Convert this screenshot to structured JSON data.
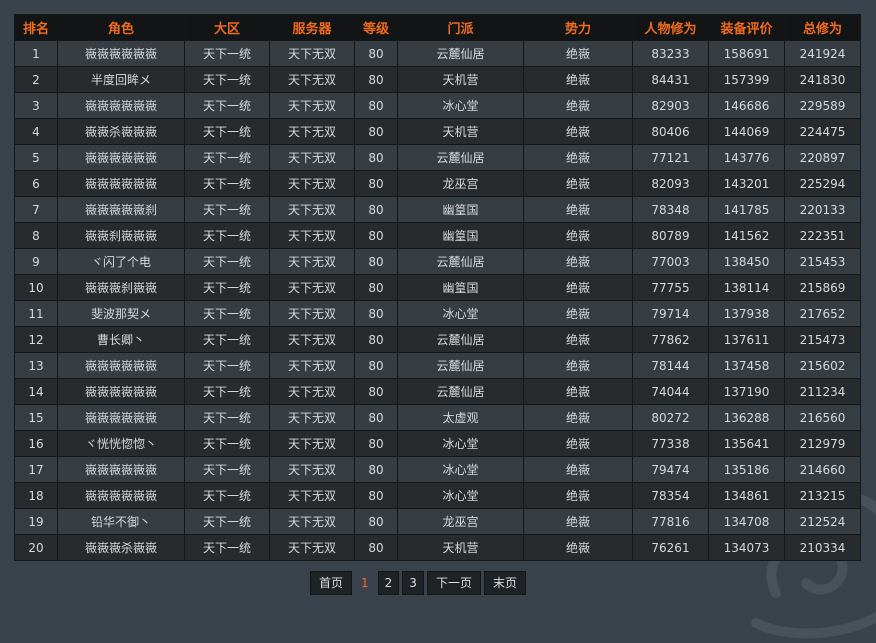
{
  "colors": {
    "header_text": "#ee6b1f",
    "header_bg": "#121415",
    "row_odd": "#363d43",
    "row_even": "#272b2e",
    "page_bg": "#3a434b"
  },
  "table": {
    "headers": [
      "排名",
      "角色",
      "大区",
      "服务器",
      "等级",
      "门派",
      "势力",
      "人物修为",
      "装备评价",
      "总修为"
    ],
    "rows": [
      [
        "1",
        "嶶嶶嶶嶶嶶嶶",
        "天下一统",
        "天下无双",
        "80",
        "云麓仙居",
        "绝嶶",
        "83233",
        "158691",
        "241924"
      ],
      [
        "2",
        "半度回眸メ",
        "天下一统",
        "天下无双",
        "80",
        "天机营",
        "绝嶶",
        "84431",
        "157399",
        "241830"
      ],
      [
        "3",
        "嶶嶶嶶嶶嶶嶶",
        "天下一统",
        "天下无双",
        "80",
        "冰心堂",
        "绝嶶",
        "82903",
        "146686",
        "229589"
      ],
      [
        "4",
        "嶶嶶杀嶶嶶嶶",
        "天下一统",
        "天下无双",
        "80",
        "天机营",
        "绝嶶",
        "80406",
        "144069",
        "224475"
      ],
      [
        "5",
        "嶶嶶嶶嶶嶶嶶",
        "天下一统",
        "天下无双",
        "80",
        "云麓仙居",
        "绝嶶",
        "77121",
        "143776",
        "220897"
      ],
      [
        "6",
        "嶶嶶嶶嶶嶶嶶",
        "天下一统",
        "天下无双",
        "80",
        "龙巫宫",
        "绝嶶",
        "82093",
        "143201",
        "225294"
      ],
      [
        "7",
        "嶶嶶嶶嶶嶶刹",
        "天下一统",
        "天下无双",
        "80",
        "幽篁国",
        "绝嶶",
        "78348",
        "141785",
        "220133"
      ],
      [
        "8",
        "嶶嶶刹嶶嶶嶶",
        "天下一统",
        "天下无双",
        "80",
        "幽篁国",
        "绝嶶",
        "80789",
        "141562",
        "222351"
      ],
      [
        "9",
        "ヾ闪了个电",
        "天下一统",
        "天下无双",
        "80",
        "云麓仙居",
        "绝嶶",
        "77003",
        "138450",
        "215453"
      ],
      [
        "10",
        "嶶嶶嶶刹嶶嶶",
        "天下一统",
        "天下无双",
        "80",
        "幽篁国",
        "绝嶶",
        "77755",
        "138114",
        "215869"
      ],
      [
        "11",
        "斐波那契メ",
        "天下一统",
        "天下无双",
        "80",
        "冰心堂",
        "绝嶶",
        "79714",
        "137938",
        "217652"
      ],
      [
        "12",
        "曹长卿丶",
        "天下一统",
        "天下无双",
        "80",
        "云麓仙居",
        "绝嶶",
        "77862",
        "137611",
        "215473"
      ],
      [
        "13",
        "嶶嶶嶶嶶嶶嶶",
        "天下一统",
        "天下无双",
        "80",
        "云麓仙居",
        "绝嶶",
        "78144",
        "137458",
        "215602"
      ],
      [
        "14",
        "嶶嶶嶶嶶嶶嶶",
        "天下一统",
        "天下无双",
        "80",
        "云麓仙居",
        "绝嶶",
        "74044",
        "137190",
        "211234"
      ],
      [
        "15",
        "嶶嶶嶶嶶嶶嶶",
        "天下一统",
        "天下无双",
        "80",
        "太虚观",
        "绝嶶",
        "80272",
        "136288",
        "216560"
      ],
      [
        "16",
        "ヾ恍恍惚惚丶",
        "天下一统",
        "天下无双",
        "80",
        "冰心堂",
        "绝嶶",
        "77338",
        "135641",
        "212979"
      ],
      [
        "17",
        "嶶嶶嶶嶶嶶嶶",
        "天下一统",
        "天下无双",
        "80",
        "冰心堂",
        "绝嶶",
        "79474",
        "135186",
        "214660"
      ],
      [
        "18",
        "嶶嶶嶶嶶嶶嶶",
        "天下一统",
        "天下无双",
        "80",
        "冰心堂",
        "绝嶶",
        "78354",
        "134861",
        "213215"
      ],
      [
        "19",
        "铅华不御丶",
        "天下一统",
        "天下无双",
        "80",
        "龙巫宫",
        "绝嶶",
        "77816",
        "134708",
        "212524"
      ],
      [
        "20",
        "嶶嶶嶶杀嶶嶶",
        "天下一统",
        "天下无双",
        "80",
        "天机营",
        "绝嶶",
        "76261",
        "134073",
        "210334"
      ]
    ]
  },
  "pager": {
    "first": "首页",
    "current": "1",
    "pages": [
      "2",
      "3"
    ],
    "next": "下一页",
    "last": "末页"
  }
}
